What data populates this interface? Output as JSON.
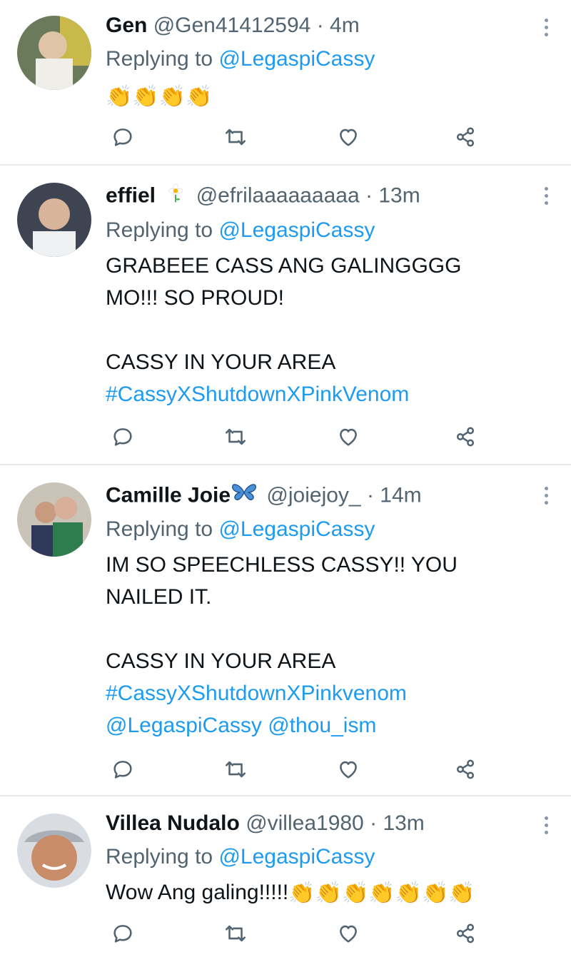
{
  "tweets": [
    {
      "name": "Gen",
      "handle": "@Gen41412594",
      "separator": "·",
      "time": "4m",
      "replying_prefix": "Replying to ",
      "replying_to": "@LegaspiCassy",
      "body": "👏👏👏👏",
      "avatar_icon": "profile-photo"
    },
    {
      "name": "effiel",
      "badge_icon": "flower-icon",
      "handle": "@efrilaaaaaaaaa",
      "separator": "·",
      "time": "13m",
      "replying_prefix": "Replying to ",
      "replying_to": "@LegaspiCassy",
      "body_lines": [
        "GRABEEE CASS ANG GALINGGGG",
        "MO!!! SO PROUD!",
        "",
        "CASSY IN YOUR AREA"
      ],
      "hashtag": "#CassyXShutdownXPinkVenom",
      "avatar_icon": "profile-photo"
    },
    {
      "name": "Camille Joie",
      "badge_icon": "butterfly-icon",
      "handle": "@joiejoy_",
      "separator": "·",
      "time": "14m",
      "replying_prefix": "Replying to ",
      "replying_to": "@LegaspiCassy",
      "body_lines": [
        "IM SO SPEECHLESS CASSY!! YOU",
        "NAILED IT.",
        "",
        "CASSY IN YOUR AREA"
      ],
      "hashtag": "#CassyXShutdownXPinkvenom",
      "mentions": "@LegaspiCassy @thou_ism",
      "avatar_icon": "profile-photo"
    },
    {
      "name": "Villea Nudalo",
      "handle": "@villea1980",
      "separator": "·",
      "time": "13m",
      "replying_prefix": "Replying to ",
      "replying_to": "@LegaspiCassy",
      "body_text": "Wow Ang galing!!!!!",
      "body_emoji": "👏👏👏👏👏👏👏",
      "avatar_icon": "profile-photo"
    }
  ],
  "action_icons": [
    "reply-icon",
    "retweet-icon",
    "like-icon",
    "share-icon"
  ],
  "colors": {
    "link": "#1d9bf0",
    "secondary_text": "#536471",
    "primary_text": "#0f1419",
    "divider": "#e7e9ec"
  }
}
